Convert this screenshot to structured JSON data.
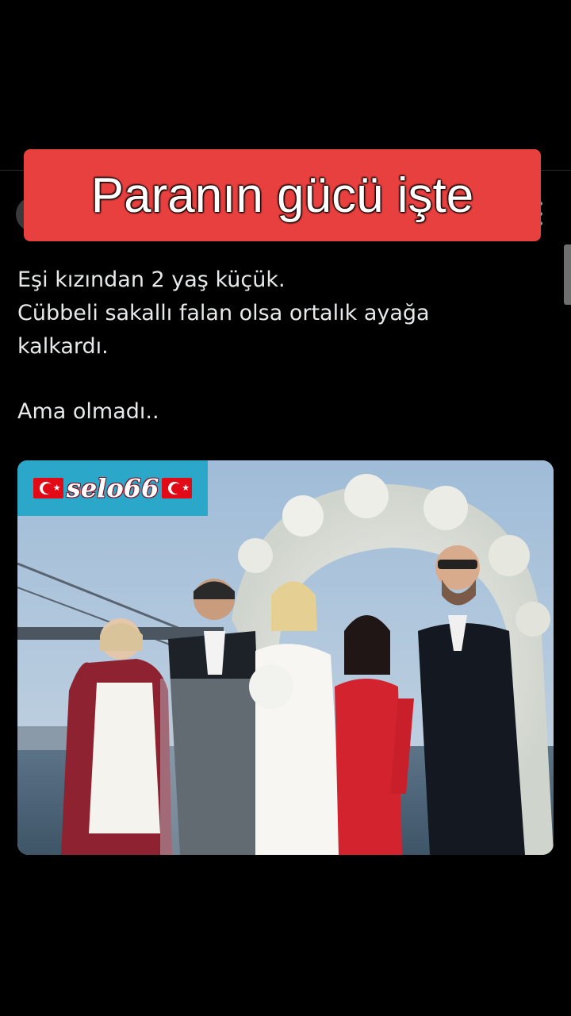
{
  "caption": {
    "text": "Paranın gücü işte"
  },
  "tweet": {
    "lines": [
      "Eşi kızından 2 yaş küçük.",
      "Cübbeli sakallı falan olsa ortalık ayağa",
      "kalkardı."
    ],
    "second_paragraph": "Ama olmadı.."
  },
  "photo": {
    "watermark": "selo66"
  },
  "colors": {
    "background": "#000000",
    "caption_banner": "#e8403e",
    "watermark_bg": "#2aa7c9",
    "text": "#e7e9ea"
  },
  "icons": {
    "more": "more-vertical-icon",
    "flag": "turkish-flag-icon"
  }
}
